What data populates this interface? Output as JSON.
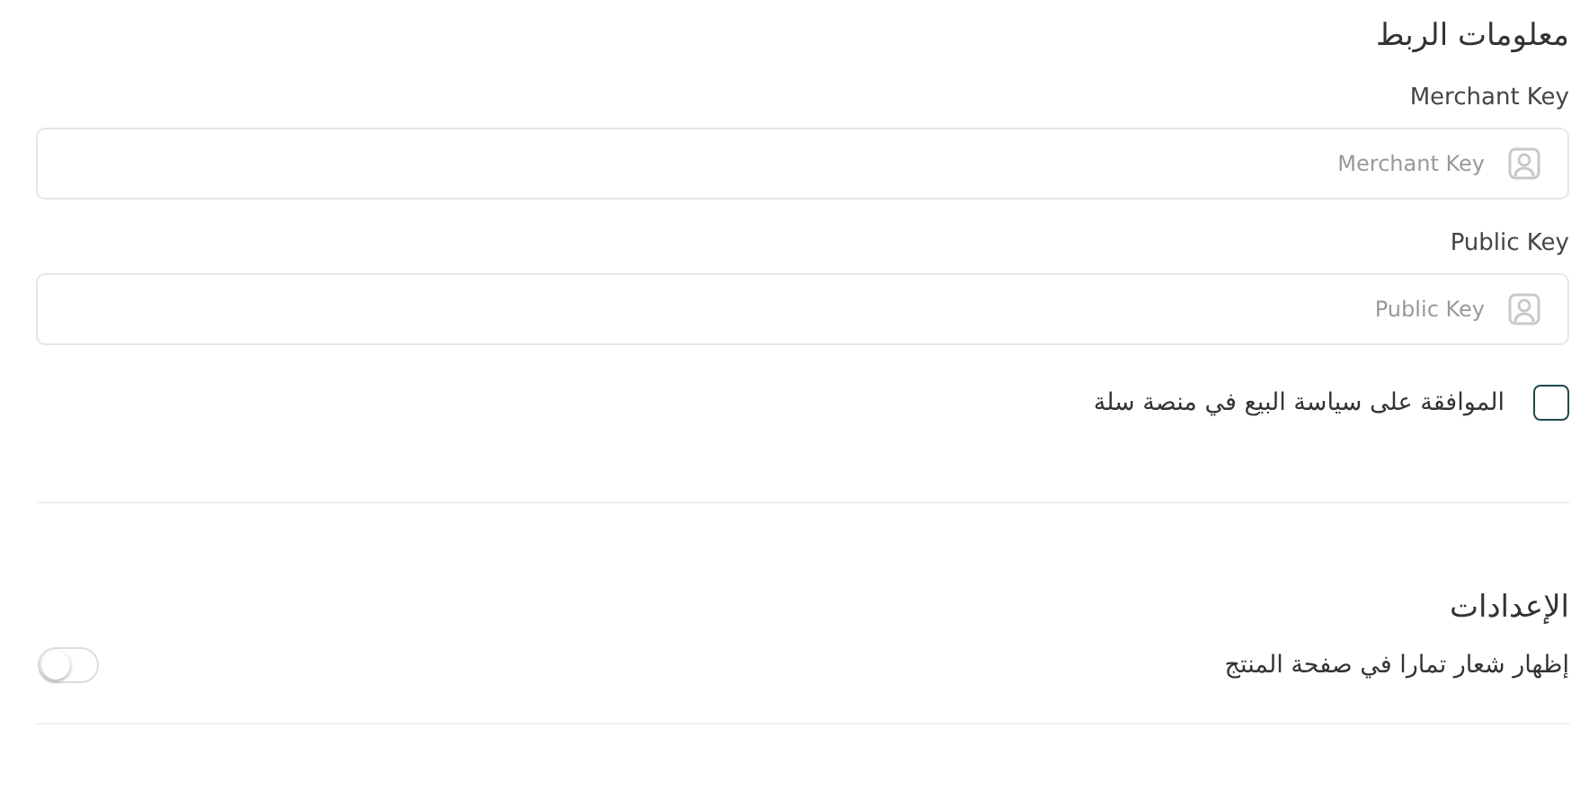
{
  "connection": {
    "title": "معلومات الربط",
    "fields": [
      {
        "label": "Merchant Key",
        "placeholder": "Merchant Key"
      },
      {
        "label": "Public Key",
        "placeholder": "Public Key"
      }
    ],
    "agreement": {
      "label": "الموافقة على سياسة البيع في منصة سلة",
      "checked": false
    }
  },
  "settings": {
    "title": "الإعدادات",
    "toggles": [
      {
        "label": "إظهار شعار تمارا في صفحة المنتج",
        "on": false
      }
    ]
  }
}
